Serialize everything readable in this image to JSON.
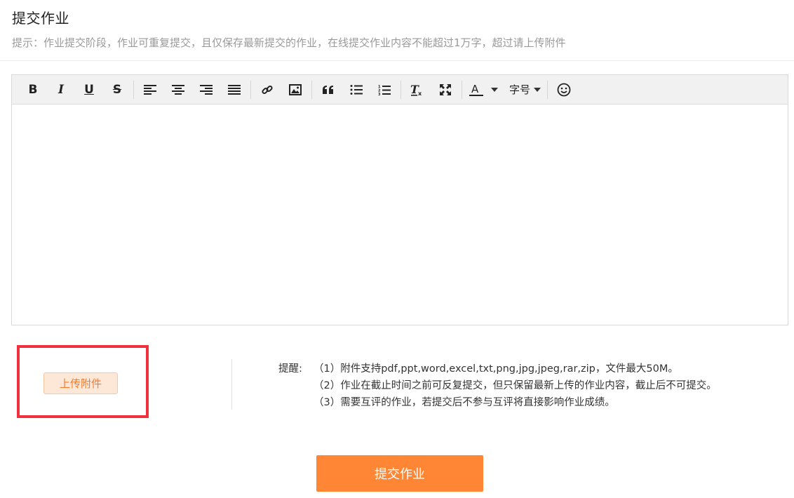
{
  "header": {
    "title": "提交作业",
    "tip": "提示：作业提交阶段，作业可重复提交，且仅保存最新提交的作业，在线提交作业内容不能超过1万字，超过请上传附件"
  },
  "toolbar": {
    "bold": "B",
    "italic": "I",
    "underline": "U",
    "strike": "S",
    "font_size_label": "字号"
  },
  "upload": {
    "label": "上传附件"
  },
  "reminder": {
    "lead": "提醒:",
    "lines": [
      "（1）附件支持pdf,ppt,word,excel,txt,png,jpg,jpeg,rar,zip，文件最大50M。",
      "（2）作业在截止时间之前可反复提交，但只保留最新上传的作业内容，截止后不可提交。",
      "（3）需要互评的作业，若提交后不参与互评将直接影响作业成绩。"
    ]
  },
  "submit": {
    "label": "提交作业"
  },
  "colors": {
    "accent": "#ff8635",
    "highlight_border": "#f0303c",
    "upload_bg": "#fde8d8"
  }
}
